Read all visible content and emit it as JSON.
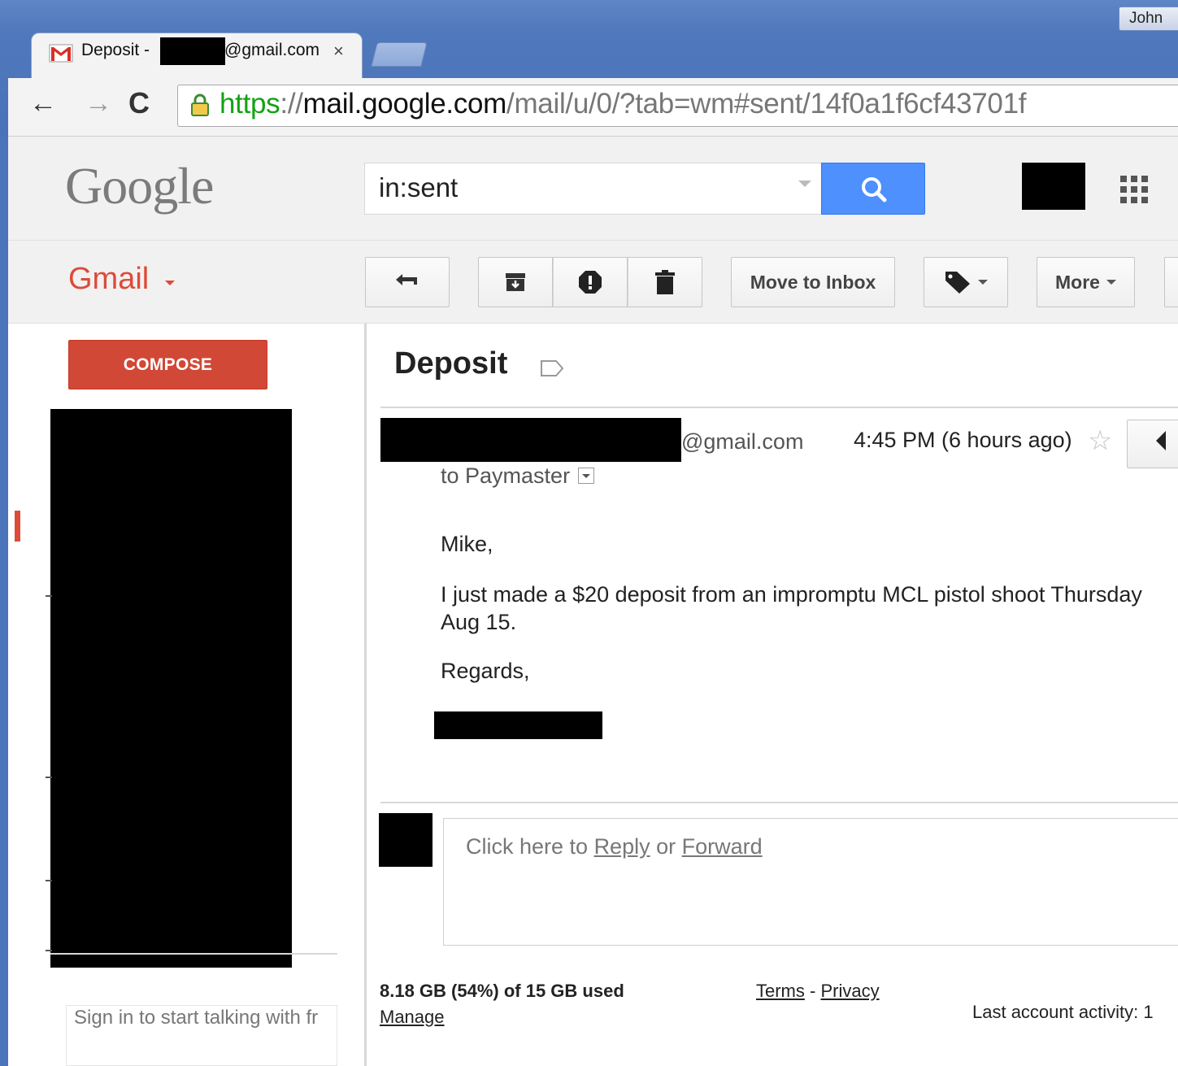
{
  "browser": {
    "user_label": "John",
    "tab": {
      "title_prefix": "Deposit -",
      "title_suffix": "@gmail.com",
      "close_glyph": "×"
    },
    "nav": {
      "back": "←",
      "forward": "→",
      "reload": "C"
    },
    "url": {
      "scheme": "https",
      "sep": "://",
      "host": "mail.google.com",
      "path": "/mail/u/0/?tab=wm#sent/14f0a1f6cf43701f"
    }
  },
  "header": {
    "logo": "Google",
    "search_value": "in:sent"
  },
  "action_bar": {
    "app_label": "Gmail",
    "move_to_inbox": "Move to Inbox",
    "more": "More"
  },
  "nav": {
    "compose": "COMPOSE",
    "chat_signin": "Sign in to start talking with fr"
  },
  "message": {
    "subject": "Deposit",
    "sender_email_suffix": "@gmail.com",
    "time": "4:45 PM (6 hours ago)",
    "to_line": "to Paymaster",
    "body": {
      "greeting": "Mike,",
      "line1": "I just made a $20 deposit from an impromptu MCL pistol shoot Thursday",
      "line2": "Aug 15.",
      "regards": "Regards,"
    },
    "reply_prompt": {
      "prefix": "Click here to ",
      "reply": "Reply",
      "middle": " or ",
      "forward": "Forward"
    }
  },
  "footer": {
    "storage": "8.18 GB (54%) of 15 GB used",
    "manage": "Manage",
    "terms": "Terms",
    "dash": " - ",
    "privacy": "Privacy",
    "last_activity": "Last account activity: 1"
  },
  "colors": {
    "gmail_red": "#dd4b39",
    "compose_red": "#d14836",
    "search_blue": "#4d90fe",
    "chrome_frame_blue": "#4f78bd",
    "https_green": "#13a313"
  },
  "icons": {
    "tab_favicon": "gmail-m-icon",
    "lock": "lock-icon",
    "search": "search-icon",
    "apps": "apps-grid-icon",
    "back": "reply-arrow-icon",
    "archive": "archive-icon",
    "spam": "report-spam-icon",
    "delete": "trash-icon",
    "labels": "label-tag-icon",
    "important": "label-outline-icon",
    "star": "star-icon"
  }
}
